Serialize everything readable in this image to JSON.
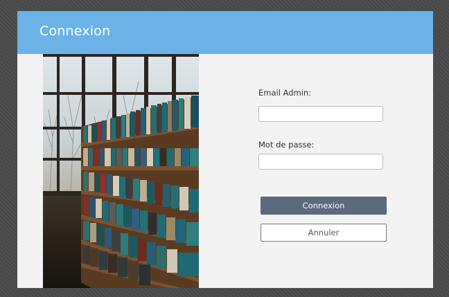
{
  "dialog": {
    "title": "Connexion"
  },
  "form": {
    "email_label": "Email Admin:",
    "email_value": "",
    "password_label": "Mot de passe:",
    "password_value": "",
    "submit_label": "Connexion",
    "cancel_label": "Annuler"
  },
  "colors": {
    "header": "#6ab2e7",
    "primary_button": "#5b6a7d",
    "panel": "#f3f3f3"
  }
}
